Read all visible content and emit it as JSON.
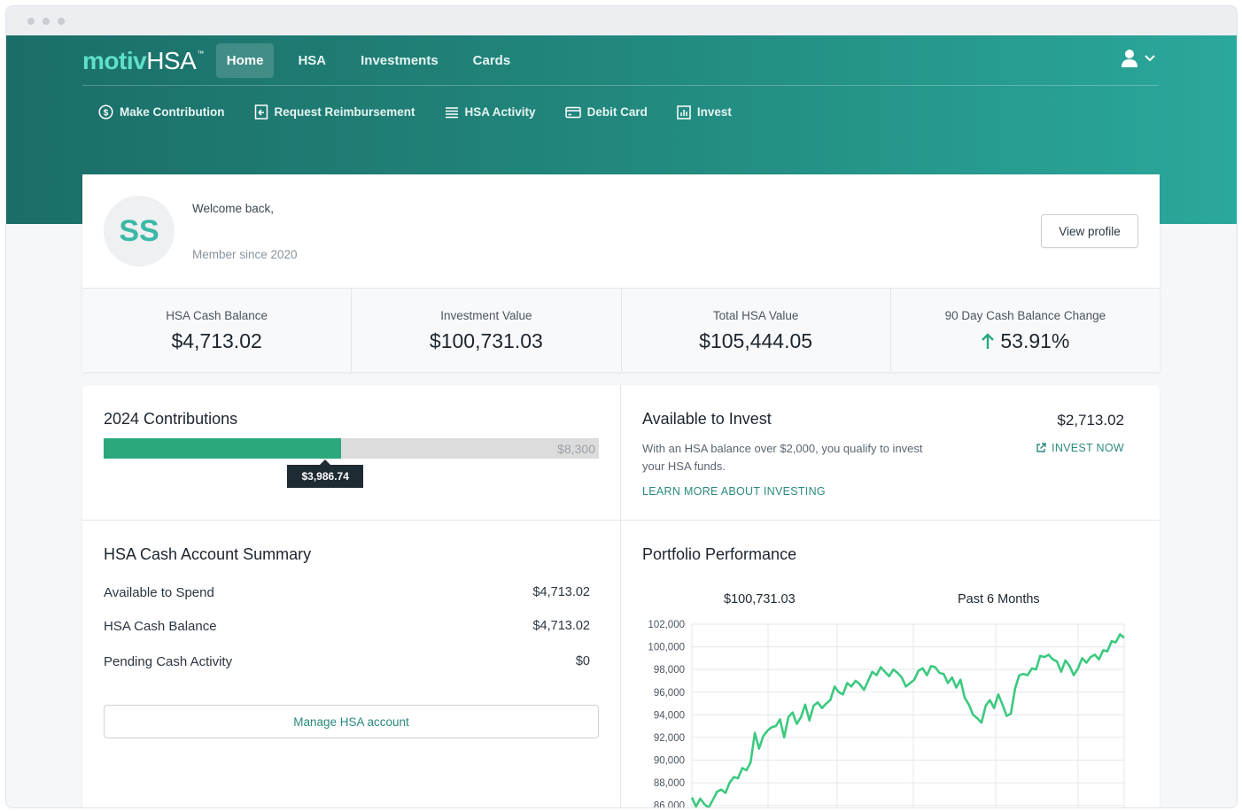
{
  "brand": {
    "logo_part1": "motiv",
    "logo_part2": "HSA",
    "logo_tm": "™"
  },
  "nav": {
    "tabs": [
      {
        "label": "Home",
        "active": true
      },
      {
        "label": "HSA"
      },
      {
        "label": "Investments"
      },
      {
        "label": "Cards"
      }
    ]
  },
  "actions": [
    {
      "label": "Make Contribution",
      "icon": "dollar-circle-icon"
    },
    {
      "label": "Request Reimbursement",
      "icon": "receipt-return-icon"
    },
    {
      "label": "HSA Activity",
      "icon": "list-icon"
    },
    {
      "label": "Debit Card",
      "icon": "credit-card-icon"
    },
    {
      "label": "Invest",
      "icon": "bar-chart-icon"
    }
  ],
  "profile": {
    "initials": "SS",
    "welcome": "Welcome back,",
    "member_since": "Member since 2020",
    "view_profile": "View profile"
  },
  "stats": [
    {
      "label": "HSA Cash Balance",
      "value": "$4,713.02"
    },
    {
      "label": "Investment Value",
      "value": "$100,731.03"
    },
    {
      "label": "Total HSA Value",
      "value": "$105,444.05"
    },
    {
      "label": "90 Day Cash Balance Change",
      "value": "53.91%",
      "trend": "up"
    }
  ],
  "contributions": {
    "title": "2024 Contributions",
    "max_label": "$8,300",
    "current_label": "$3,986.74",
    "fraction": 0.4803
  },
  "invest": {
    "title": "Available to Invest",
    "amount": "$2,713.02",
    "description": "With an HSA balance over $2,000, you qualify to invest your HSA funds.",
    "learn_more": "LEARN MORE ABOUT INVESTING",
    "invest_now": "INVEST NOW"
  },
  "summary": {
    "title": "HSA Cash Account Summary",
    "rows": [
      {
        "label": "Available to Spend",
        "value": "$4,713.02"
      },
      {
        "label": "HSA Cash Balance",
        "value": "$4,713.02"
      },
      {
        "label": "Pending Cash Activity",
        "value": "$0"
      }
    ],
    "manage_button": "Manage HSA account"
  },
  "portfolio": {
    "title": "Portfolio Performance",
    "value": "$100,731.03",
    "period": "Past 6 Months"
  },
  "colors": {
    "accent": "#2aa87c",
    "brand_dark": "#1b6e68",
    "brand_light": "#2aa89b",
    "line": "#3cc97f"
  },
  "chart_data": {
    "type": "line",
    "title": "",
    "xlabel": "",
    "ylabel": "",
    "ylim": [
      86000,
      102000
    ],
    "y_ticks": [
      "102,000",
      "100,000",
      "98,000",
      "96,000",
      "94,000",
      "92,000",
      "90,000",
      "88,000",
      "86,000"
    ],
    "grid": true,
    "series": [
      {
        "values": [
          86700,
          85900,
          86600,
          86100,
          85800,
          86500,
          87200,
          87400,
          87100,
          88000,
          88500,
          88400,
          89300,
          89100,
          89800,
          92400,
          91000,
          92100,
          92600,
          92900,
          93000,
          93600,
          92000,
          93800,
          94200,
          93200,
          93800,
          94900,
          93500,
          94800,
          95100,
          94600,
          95000,
          95300,
          96500,
          96000,
          95800,
          96800,
          96500,
          97000,
          96700,
          96200,
          97000,
          97800,
          97500,
          98200,
          97800,
          97400,
          98000,
          97700,
          97300,
          96500,
          96800,
          97100,
          97900,
          98100,
          97500,
          98300,
          98200,
          97700,
          97600,
          96800,
          97300,
          96400,
          97100,
          95500,
          94900,
          94000,
          93700,
          93300,
          94800,
          95300,
          94600,
          95800,
          94900,
          93900,
          94100,
          96300,
          97500,
          97600,
          97500,
          98100,
          98000,
          99200,
          99100,
          99300,
          98900,
          98700,
          97800,
          98800,
          98300,
          97500,
          98100,
          99000,
          98600,
          99100,
          99300,
          98900,
          99700,
          99600,
          100500,
          100400,
          101100,
          100800
        ]
      }
    ]
  }
}
